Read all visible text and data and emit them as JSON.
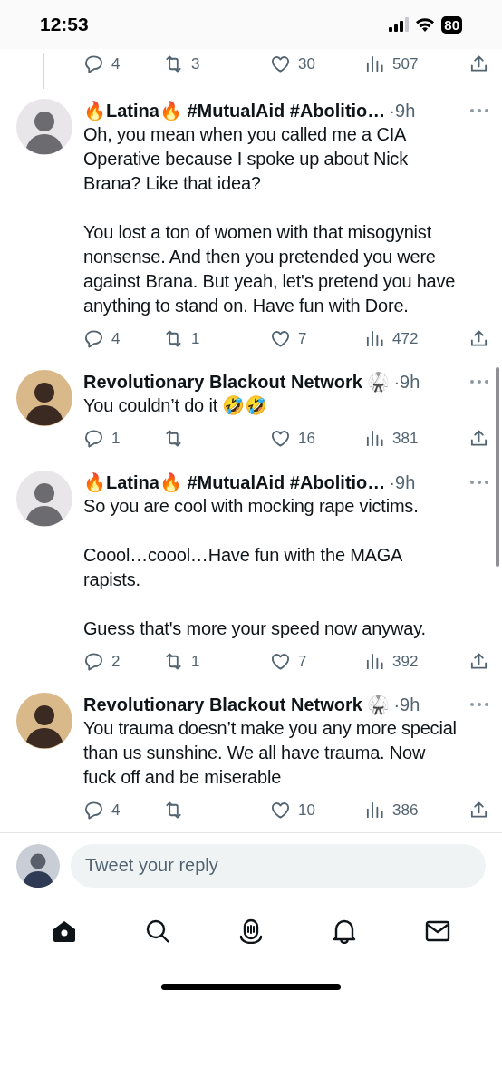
{
  "status_bar": {
    "time": "12:53",
    "battery": "80"
  },
  "previous_actions": {
    "replies": "4",
    "retweets": "3",
    "likes": "30",
    "views": "507"
  },
  "tweets": [
    {
      "author": "🔥Latina🔥 #MutualAid #Abolitio…",
      "time": "·9h",
      "text": [
        "Oh, you mean when you called me a CIA Operative because I spoke up about Nick Brana? Like that idea?",
        "You lost a ton of women with that misogynist nonsense. And then you pretended you were against Brana. But yeah, let's pretend you have anything to stand on. Have fun with Dore."
      ],
      "replies": "4",
      "retweets": "1",
      "likes": "7",
      "views": "472"
    },
    {
      "author": "Revolutionary Blackout Network 🥋",
      "time": "·9h",
      "text": [
        "You couldn’t do it 🤣🤣"
      ],
      "replies": "1",
      "likes": "16",
      "views": "381"
    },
    {
      "author": "🔥Latina🔥 #MutualAid #Abolitio…",
      "time": "·9h",
      "text": [
        "So you are cool with mocking rape victims.",
        "Coool…coool…Have fun with the MAGA rapists.",
        "Guess that's more your speed now anyway."
      ],
      "replies": "2",
      "retweets": "1",
      "likes": "7",
      "views": "392"
    },
    {
      "author": "Revolutionary Blackout Network 🥋",
      "time": "·9h",
      "text": [
        "You trauma doesn’t make you any more special than us sunshine. We all have trauma. Now fuck off and be miserable"
      ],
      "replies": "4",
      "likes": "10",
      "views": "386"
    }
  ],
  "reply_box": {
    "placeholder": "Tweet your reply"
  },
  "nav": [
    {
      "kind": "home",
      "selected": true
    },
    {
      "kind": "search",
      "selected": false
    },
    {
      "kind": "spaces",
      "selected": false
    },
    {
      "kind": "notifications",
      "selected": false
    },
    {
      "kind": "messages",
      "selected": false
    }
  ]
}
